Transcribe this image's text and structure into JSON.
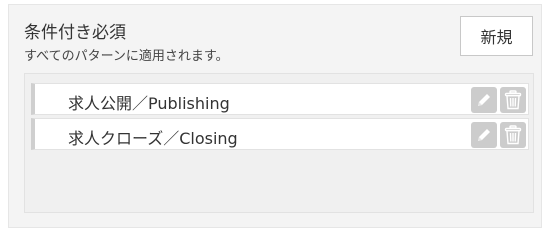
{
  "header": {
    "title": "条件付き必須",
    "subtitle": "すべてのパターンに適用されます。",
    "new_button_label": "新規"
  },
  "items": [
    {
      "label": "求人公開／Publishing",
      "edit_icon": "pencil-icon",
      "delete_icon": "trash-icon"
    },
    {
      "label": "求人クローズ／Closing",
      "edit_icon": "pencil-icon",
      "delete_icon": "trash-icon"
    }
  ],
  "colors": {
    "panel_background": "#f4f4f4",
    "icon_background": "#cccccc",
    "item_accent_border": "#cfcfcf"
  }
}
